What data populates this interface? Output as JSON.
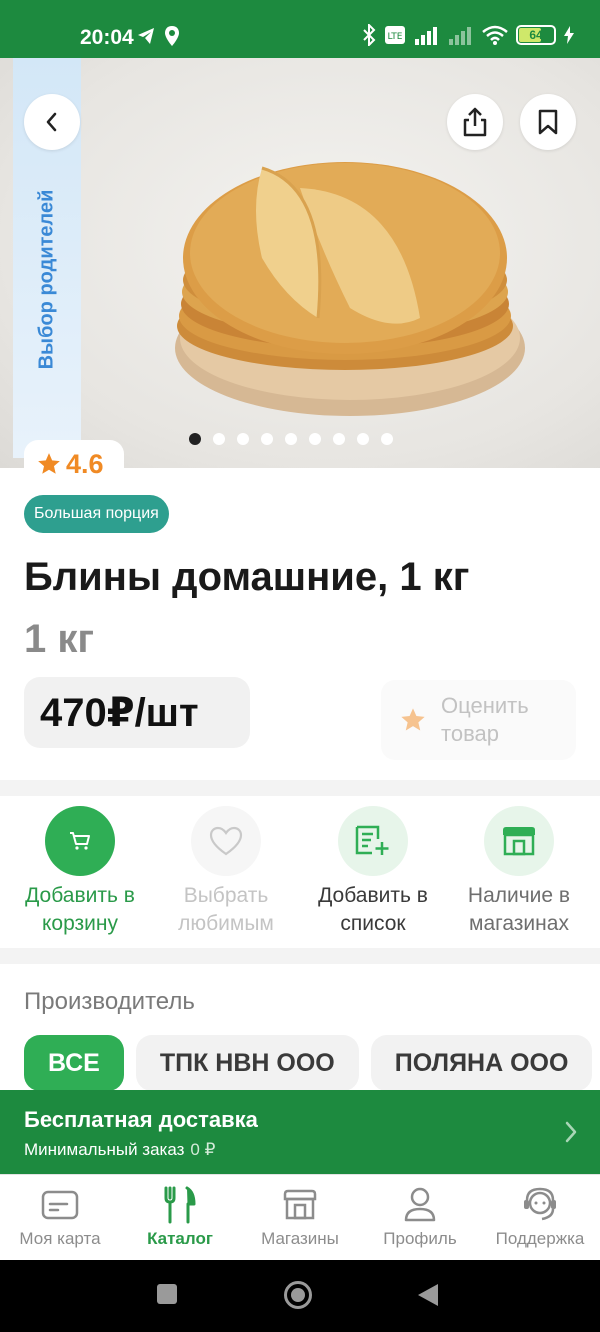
{
  "status_bar": {
    "time": "20:04",
    "battery": "64",
    "icons": [
      "telegram-icon",
      "location-icon",
      "bluetooth-icon",
      "volte-icon",
      "signal-icon",
      "signal-off-icon",
      "wifi-icon",
      "battery-icon",
      "charging-icon"
    ]
  },
  "hero": {
    "parents_choice": "Выбор родителей",
    "image": "pancakes-stack-photo",
    "slides_total": 9,
    "active_slide": 1
  },
  "product": {
    "rating": "4.6",
    "badge": "Большая порция",
    "title": "Блины домашние, 1 кг",
    "weight": "1 кг",
    "price": "470₽/шт",
    "rate_label": "Оценить товар"
  },
  "actions": [
    {
      "label": "Добавить в корзину",
      "icon": "cart-icon"
    },
    {
      "label": "Выбрать любимым",
      "icon": "heart-icon"
    },
    {
      "label": "Добавить в список",
      "icon": "add-to-list-icon"
    },
    {
      "label": "Наличие в магазинах",
      "icon": "store-icon"
    }
  ],
  "manufacturer": {
    "title": "Производитель",
    "chips": [
      "ВСЕ",
      "ТПК НВН ООО",
      "ПОЛЯНА ООО"
    ]
  },
  "delivery": {
    "title": "Бесплатная доставка",
    "subtitle": "Минимальный заказ",
    "min_value": "0 ₽"
  },
  "bottom_nav": [
    {
      "label": "Моя карта",
      "icon": "card-icon"
    },
    {
      "label": "Каталог",
      "icon": "catalog-icon"
    },
    {
      "label": "Магазины",
      "icon": "store-icon"
    },
    {
      "label": "Профиль",
      "icon": "profile-icon"
    },
    {
      "label": "Поддержка",
      "icon": "support-icon"
    }
  ],
  "colors": {
    "brand_green": "#1d8a3f",
    "accent_green": "#2fae55",
    "badge_teal": "#2e9f8f",
    "rating_orange": "#f08a24"
  }
}
